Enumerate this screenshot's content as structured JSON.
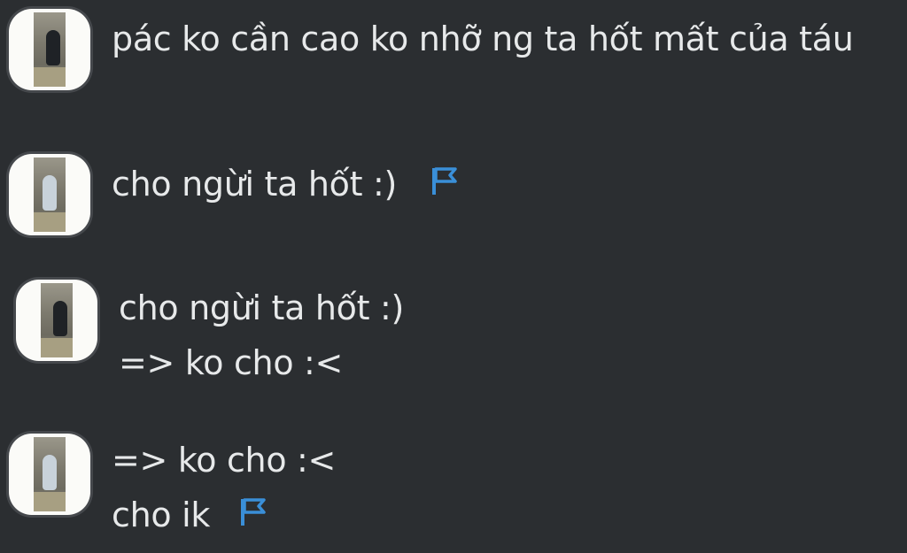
{
  "messages": [
    {
      "lines": [
        "pác ko cần cao ko nhỡ ng ta hốt mất của táu"
      ],
      "flag": false
    },
    {
      "lines": [
        "cho ngừi ta hốt :)"
      ],
      "flag": true
    },
    {
      "lines": [
        "cho ngừi ta hốt :)",
        "=> ko cho :<"
      ],
      "flag": false
    },
    {
      "lines": [
        "=> ko cho :<",
        "cho ik"
      ],
      "flag": true
    }
  ],
  "colors": {
    "background": "#2b2e31",
    "text": "#e7e9ea",
    "flag": "#3a8fd8"
  },
  "icons": {
    "flag": "flag-icon",
    "avatar": "avatar-photo"
  }
}
